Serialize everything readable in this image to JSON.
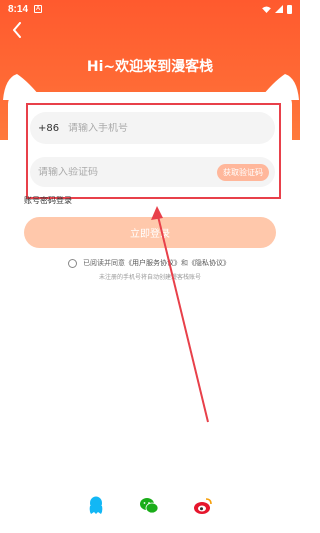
{
  "statusbar": {
    "time": "8:14",
    "app_indicator": "A"
  },
  "header": {
    "title": "Hi~欢迎来到漫客栈"
  },
  "login_form": {
    "country_code": "+86",
    "phone_placeholder": "请输入手机号",
    "code_placeholder": "请输入验证码",
    "get_code_label": "获取验证码",
    "alt_login_label": "账号密码登录",
    "login_label": "立即登录"
  },
  "agreement": {
    "prefix": "已阅读并同意",
    "user_agreement": "《用户服务协议》",
    "conjunction": "和",
    "privacy_policy": "《隐私协议》",
    "notice": "未注册的手机号将自动创建漫客栈账号"
  },
  "social_login": {
    "items": [
      {
        "icon": "qq-icon",
        "color": "#12b7f5"
      },
      {
        "icon": "wechat-icon",
        "color": "#1aad19"
      },
      {
        "icon": "weibo-icon",
        "color": "#e6162d"
      }
    ]
  },
  "colors": {
    "header": "#ff5a2e",
    "annotation": "#e8404a",
    "login_button": "#ffc8ab",
    "get_code_button": "#ffb79b"
  }
}
